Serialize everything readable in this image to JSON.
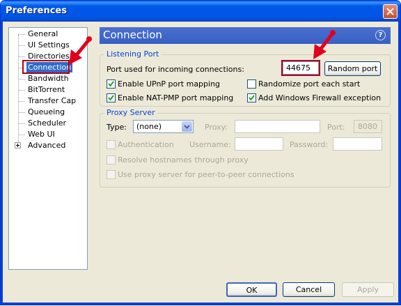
{
  "window": {
    "title": "Preferences"
  },
  "tree": {
    "items": [
      {
        "label": "General"
      },
      {
        "label": "UI Settings"
      },
      {
        "label": "Directories"
      },
      {
        "label": "Connection"
      },
      {
        "label": "Bandwidth"
      },
      {
        "label": "BitTorrent"
      },
      {
        "label": "Transfer Cap"
      },
      {
        "label": "Queueing"
      },
      {
        "label": "Scheduler"
      },
      {
        "label": "Web UI"
      },
      {
        "label": "Advanced"
      }
    ],
    "selected": "Connection"
  },
  "header": {
    "title": "Connection",
    "help": "?"
  },
  "listening": {
    "group_label": "Listening Port",
    "port_label": "Port used for incoming connections:",
    "port_value": "44675",
    "random_button": "Random port",
    "upnp": {
      "label": "Enable UPnP port mapping",
      "checked": true
    },
    "randomize": {
      "label": "Randomize port each start",
      "checked": false
    },
    "natpmp": {
      "label": "Enable NAT-PMP port mapping",
      "checked": true
    },
    "firewall": {
      "label": "Add Windows Firewall exception",
      "checked": true
    }
  },
  "proxy": {
    "group_label": "Proxy Server",
    "type_label": "Type:",
    "type_value": "(none)",
    "proxy_label": "Proxy:",
    "port_label": "Port:",
    "port_value": "8080",
    "auth_label": "Authentication",
    "username_label": "Username:",
    "password_label": "Password:",
    "resolve_label": "Resolve hostnames through proxy",
    "p2p_label": "Use proxy server for peer-to-peer connections"
  },
  "footer": {
    "ok": "OK",
    "cancel": "Cancel",
    "apply": "Apply"
  },
  "colors": {
    "titlebar": "#0055e5",
    "selection": "#316ac5",
    "header": "#3d63c8",
    "group_label": "#0046d5",
    "annotation_red": "#e0001e"
  }
}
